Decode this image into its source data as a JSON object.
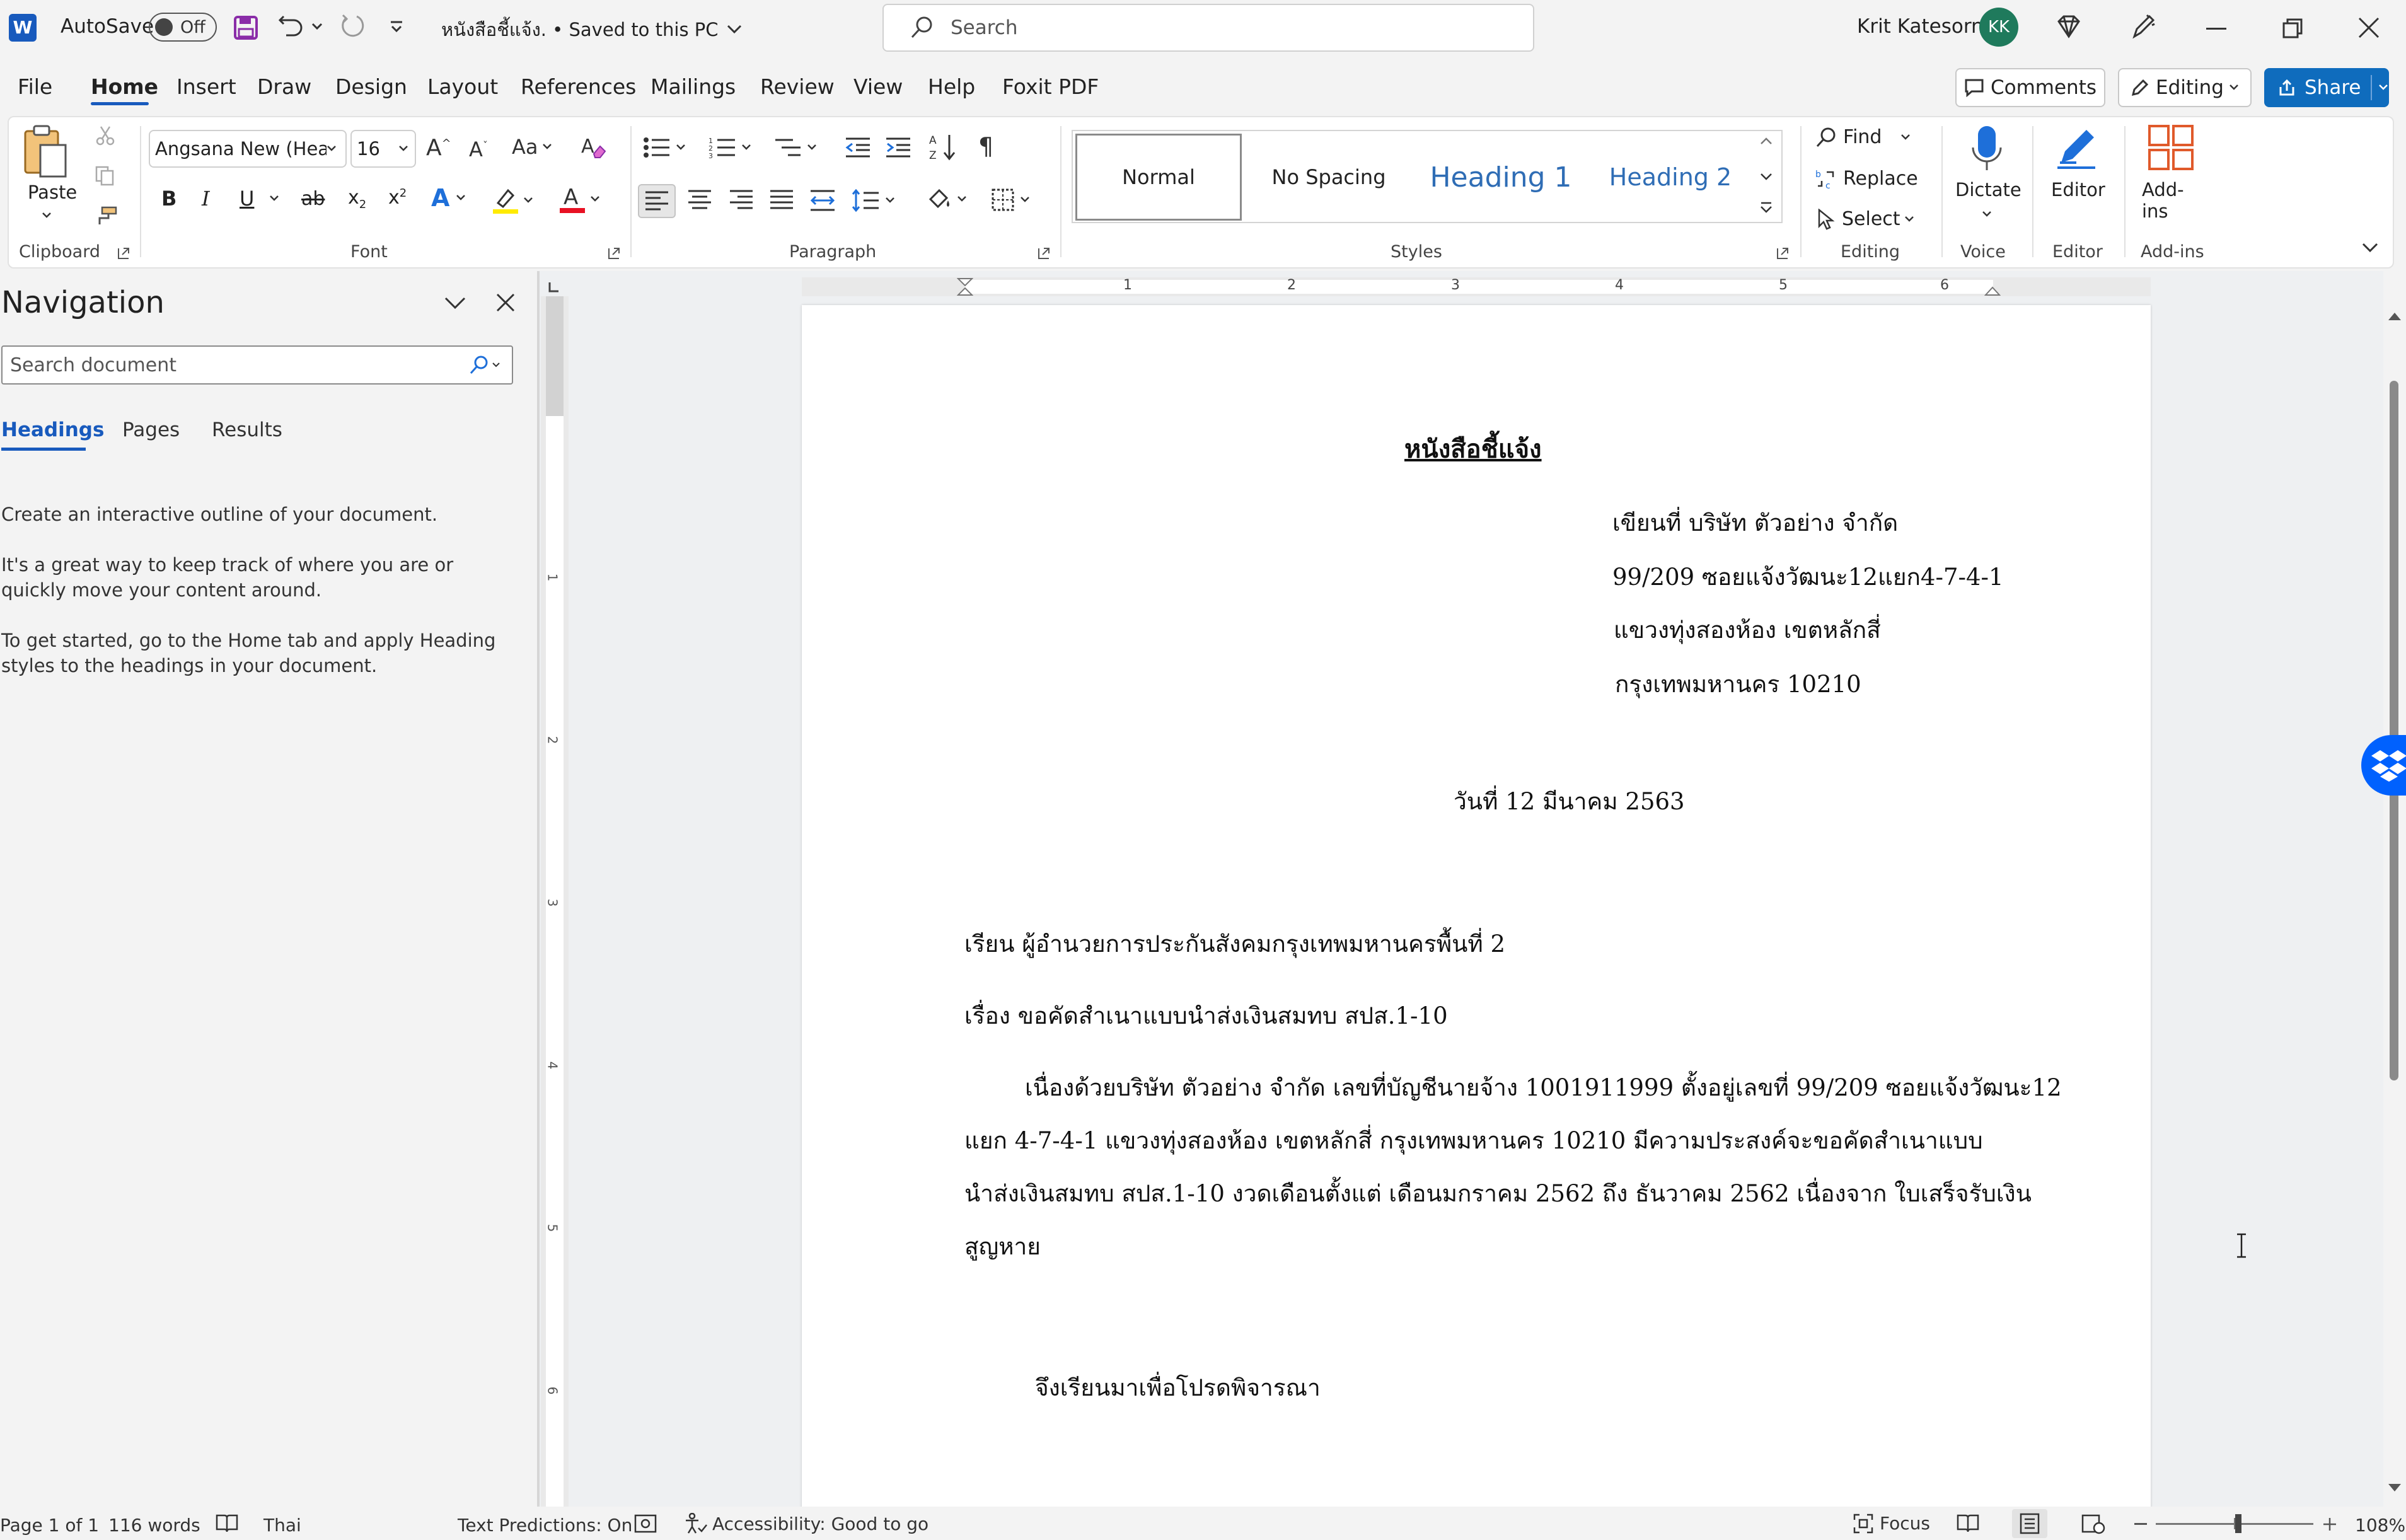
{
  "titlebar": {
    "autosave_label": "AutoSave",
    "autosave_state": "Off",
    "doc_title": "หนังสือชี้แจ้ง. • Saved to this PC",
    "search_placeholder": "Search",
    "user_name": "Krit Katesorn",
    "user_initials": "KK"
  },
  "menu": {
    "tabs": [
      "File",
      "Home",
      "Insert",
      "Draw",
      "Design",
      "Layout",
      "References",
      "Mailings",
      "Review",
      "View",
      "Help",
      "Foxit PDF"
    ],
    "active_tab": "Home",
    "comments_label": "Comments",
    "editing_label": "Editing",
    "share_label": "Share"
  },
  "ribbon": {
    "clipboard": {
      "paste_label": "Paste",
      "group_label": "Clipboard"
    },
    "font": {
      "font_name": "Angsana New (Headi",
      "font_size": "16",
      "group_label": "Font"
    },
    "paragraph": {
      "group_label": "Paragraph"
    },
    "styles": {
      "items": [
        "Normal",
        "No Spacing",
        "Heading 1",
        "Heading 2"
      ],
      "group_label": "Styles"
    },
    "editing": {
      "find_label": "Find",
      "replace_label": "Replace",
      "select_label": "Select",
      "group_label": "Editing"
    },
    "voice": {
      "dictate_label": "Dictate",
      "group_label": "Voice"
    },
    "editor": {
      "editor_label": "Editor",
      "group_label": "Editor"
    },
    "addins": {
      "addins_label": "Add-ins",
      "group_label": "Add-ins"
    }
  },
  "navigation": {
    "title": "Navigation",
    "search_placeholder": "Search document",
    "tabs": [
      "Headings",
      "Pages",
      "Results"
    ],
    "active_tab": "Headings",
    "help": [
      "Create an interactive outline of your document.",
      "It's a great way to keep track of where you are or quickly move your content around.",
      "To get started, go to the Home tab and apply Heading styles to the headings in your document."
    ]
  },
  "ruler": {
    "h_labels": [
      "1",
      "2",
      "3",
      "4",
      "5",
      "6"
    ],
    "v_labels": [
      "1",
      "2",
      "3",
      "4",
      "5",
      "6"
    ]
  },
  "document": {
    "title": "หนังสือชี้แจ้ง",
    "address": [
      "เขียนที่ บริษัท ตัวอย่าง จำกัด",
      "99/209 ซอยแจ้งวัฒนะ12แยก4-7-4-1",
      "แขวงทุ่งสองห้อง เขตหลักสี่",
      "กรุงเทพมหานคร 10210"
    ],
    "date": "วันที่ 12 มีนาคม 2563",
    "to": "เรียน ผู้อำนวยการประกันสังคมกรุงเทพมหานครพื้นที่ 2",
    "subject": "เรื่อง ขอคัดสำเนาแบบนำส่งเงินสมทบ สปส.1-10",
    "body": [
      "เนื่องด้วยบริษัท ตัวอย่าง จำกัด เลขที่บัญชีนายจ้าง 1001911999 ตั้งอยู่เลขที่ 99/209 ซอยแจ้งวัฒนะ12",
      "แยก 4-7-4-1 แขวงทุ่งสองห้อง เขตหลักสี่ กรุงเทพมหานคร 10210 มีความประสงค์จะขอคัดสำเนาแบบ",
      "นำส่งเงินสมทบ สปส.1-10 งวดเดือนตั้งแต่ เดือนมกราคม 2562 ถึง ธันวาคม 2562 เนื่องจาก ใบเสร็จรับเงิน",
      "สูญหาย"
    ],
    "closing": "จึงเรียนมาเพื่อโปรดพิจารณา"
  },
  "status": {
    "page": "Page 1 of 1",
    "words": "116 words",
    "language": "Thai",
    "text_predictions": "Text Predictions: On",
    "accessibility": "Accessibility: Good to go",
    "focus": "Focus",
    "zoom": "108%"
  },
  "colors": {
    "word_blue": "#185abd",
    "share_blue": "#0f6cbd",
    "avatar_green": "#1f7a5c",
    "save_purple": "#8a2ca8"
  }
}
